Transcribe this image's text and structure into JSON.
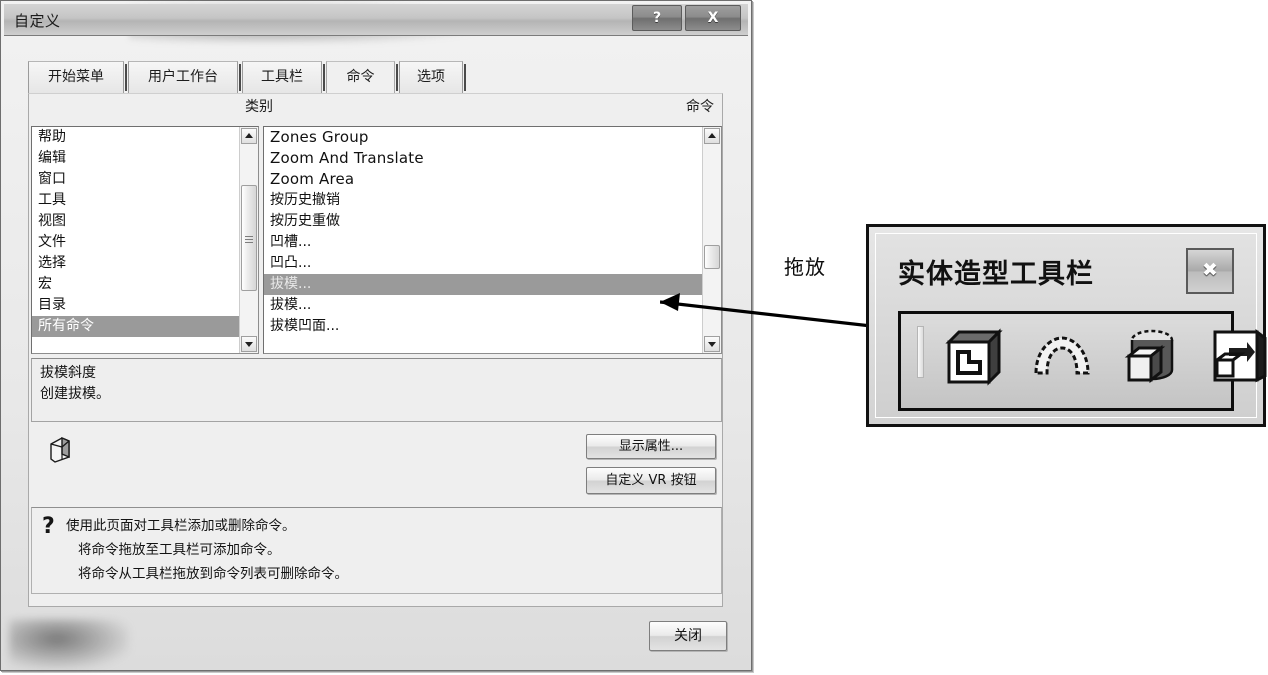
{
  "window": {
    "title": "自定义",
    "help_button": "?",
    "close_button": "X"
  },
  "tabs": [
    {
      "label": "开始菜单",
      "active": false
    },
    {
      "label": "用户工作台",
      "active": false
    },
    {
      "label": "工具栏",
      "active": false
    },
    {
      "label": "命令",
      "active": true
    },
    {
      "label": "选项",
      "active": false
    }
  ],
  "columns": {
    "category_header": "类别",
    "command_header": "命令"
  },
  "category_list": [
    {
      "label": "帮助",
      "selected": false
    },
    {
      "label": "编辑",
      "selected": false
    },
    {
      "label": "窗口",
      "selected": false
    },
    {
      "label": "工具",
      "selected": false
    },
    {
      "label": "视图",
      "selected": false
    },
    {
      "label": "文件",
      "selected": false
    },
    {
      "label": "选择",
      "selected": false
    },
    {
      "label": "宏",
      "selected": false
    },
    {
      "label": "目录",
      "selected": false
    },
    {
      "label": "所有命令",
      "selected": true
    }
  ],
  "command_list": [
    {
      "label": "Zones Group",
      "selected": false,
      "latin": true
    },
    {
      "label": "Zoom And Translate",
      "selected": false,
      "latin": true
    },
    {
      "label": "Zoom Area",
      "selected": false,
      "latin": true
    },
    {
      "label": "按历史撤销",
      "selected": false,
      "latin": false
    },
    {
      "label": "按历史重做",
      "selected": false,
      "latin": false
    },
    {
      "label": "凹槽...",
      "selected": false,
      "latin": false
    },
    {
      "label": "凹凸...",
      "selected": false,
      "latin": false
    },
    {
      "label": "拔模...",
      "selected": true,
      "latin": false
    },
    {
      "label": "拔模...",
      "selected": false,
      "latin": false
    },
    {
      "label": "拔模凹面...",
      "selected": false,
      "latin": false
    }
  ],
  "description": {
    "title": "拔模斜度",
    "body": "创建拔模。"
  },
  "action_buttons": {
    "show_properties": "显示属性...",
    "custom_vr_button": "自定义 VR 按钮"
  },
  "hint": {
    "marker": "?",
    "line1": "使用此页面对工具栏添加或删除命令。",
    "line2": "将命令拖放至工具栏可添加命令。",
    "line3": "将命令从工具栏拖放到命令列表可删除命令。"
  },
  "footer": {
    "close": "关闭"
  },
  "annotation": {
    "drag_label": "拖放"
  },
  "floating_toolbar": {
    "title": "实体造型工具栏",
    "close_button": "✖",
    "icons": [
      {
        "name": "pocket-icon"
      },
      {
        "name": "dome-shell-icon"
      },
      {
        "name": "draft-taper-icon"
      },
      {
        "name": "extrude-icon"
      }
    ]
  },
  "colors": {
    "selection": "#9a9a9a",
    "dialog_face": "#efefef",
    "border": "#8d8d8d",
    "accent_black": "#111111"
  }
}
